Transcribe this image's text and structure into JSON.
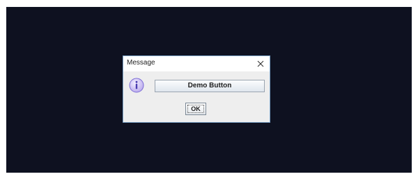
{
  "dialog": {
    "title": "Message",
    "close_icon": "close-icon",
    "message_icon": "info-icon",
    "demo_button_label": "Demo Button",
    "ok_button_label": "OK"
  },
  "colors": {
    "desktop_background": "#0e1120",
    "dialog_background": "#eeeeee",
    "dialog_border": "#7da4c8",
    "info_icon_fill": "#c9bcf0",
    "info_icon_stroke": "#6a5acd"
  }
}
